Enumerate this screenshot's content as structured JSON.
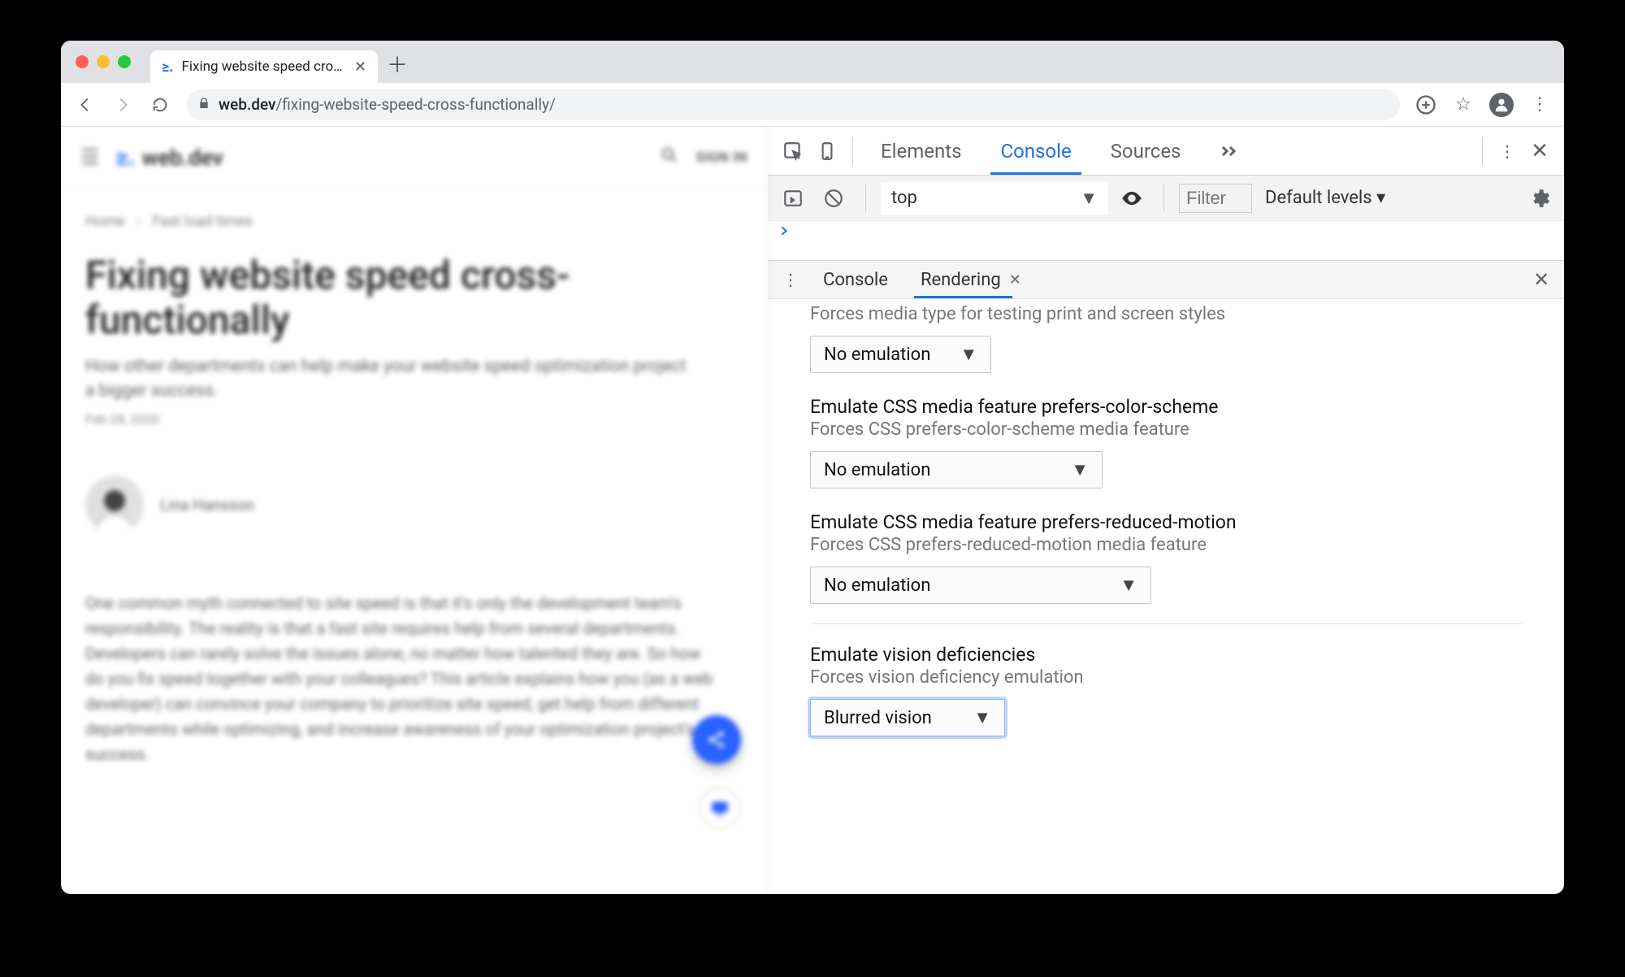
{
  "browser": {
    "tab_title": "Fixing website speed cross-fun…",
    "url_display_host": "web.dev",
    "url_display_path": "/fixing-website-speed-cross-functionally/"
  },
  "page": {
    "brand": "web.dev",
    "signin": "SIGN IN",
    "breadcrumbs": {
      "a": "Home",
      "b": "Fast load times"
    },
    "h1": "Fixing website speed cross-functionally",
    "sub": "How other departments can help make your website speed optimization project a bigger success.",
    "date": "Feb 28, 2020",
    "author": "Lina Hansson",
    "body": "One common myth connected to site speed is that it's only the development team's responsibility. The reality is that a fast site requires help from several departments. Developers can rarely solve the issues alone, no matter how talented they are. So how do you fix speed together with your colleagues? This article explains how you (as a web developer) can convince your company to prioritize site speed, get help from different departments while optimizing, and increase awareness of your optimization project's success."
  },
  "devtools": {
    "top_tabs": {
      "elements": "Elements",
      "console": "Console",
      "sources": "Sources"
    },
    "context": "top",
    "filter_placeholder": "Filter",
    "levels": "Default levels ▾",
    "drawer_tabs": {
      "console": "Console",
      "rendering": "Rendering"
    },
    "rendering": {
      "s1": {
        "desc": "Forces media type for testing print and screen styles",
        "value": "No emulation"
      },
      "s2": {
        "title": "Emulate CSS media feature prefers-color-scheme",
        "desc": "Forces CSS prefers-color-scheme media feature",
        "value": "No emulation"
      },
      "s3": {
        "title": "Emulate CSS media feature prefers-reduced-motion",
        "desc": "Forces CSS prefers-reduced-motion media feature",
        "value": "No emulation"
      },
      "s4": {
        "title": "Emulate vision deficiencies",
        "desc": "Forces vision deficiency emulation",
        "value": "Blurred vision"
      }
    }
  }
}
